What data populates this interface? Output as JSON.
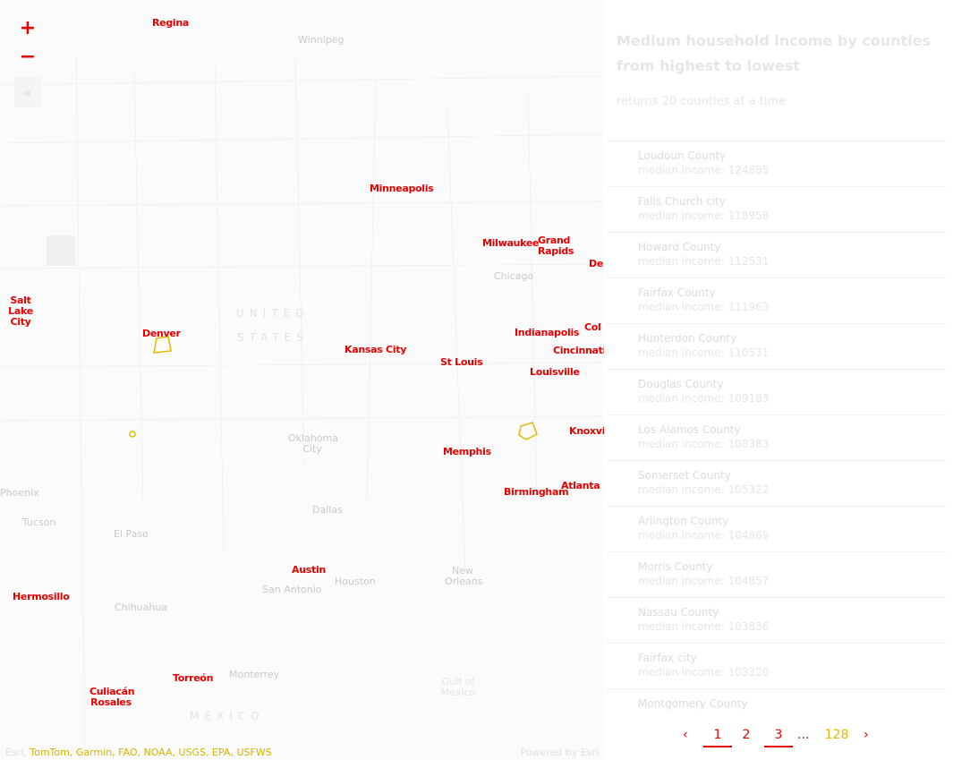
{
  "map": {
    "zoom_in_symbol": "+",
    "zoom_out_symbol": "−",
    "collapse_symbol": "«",
    "cities": [
      "Regina",
      "Minneapolis",
      "Milwaukee",
      "Grand Rapids",
      "Salt Lake City",
      "Denver",
      "Kansas City",
      "St Louis",
      "Indianapolis",
      "Cincinnati",
      "Louisville",
      "Memphis",
      "Birmingham",
      "Atlanta",
      "Austin",
      "Hermosillo",
      "Torreón",
      "Culiacán Rosales"
    ],
    "basemap_labels": [
      "Winnipeg",
      "Chicago",
      "Oklahoma City",
      "Dallas",
      "Phoenix",
      "Tucson",
      "El Paso",
      "San Antonio",
      "Houston",
      "New Orleans",
      "Chihuahua",
      "Monterrey",
      "Gulf of Mexico"
    ],
    "country_labels": [
      "UNITED",
      "STATES",
      "MEXICO"
    ],
    "edge_labels": [
      "De",
      "Col",
      "Knoxvill"
    ],
    "attribution_left_prefix": "Esri, ",
    "attribution_left": "TomTom, Garmin, FAO, NOAA, USGS, EPA, USFWS",
    "attribution_right": "Powered by Esri"
  },
  "panel": {
    "title": "Medium household income by counties from highest to lowest",
    "subtitle": "returns 20 counties at a time",
    "income_prefix": "median income: ",
    "counties": [
      {
        "name": "Loudoun County",
        "income": "124885"
      },
      {
        "name": "Falls Church city",
        "income": "118958"
      },
      {
        "name": "Howard County",
        "income": "112531"
      },
      {
        "name": "Fairfax County",
        "income": "111963"
      },
      {
        "name": "Hunterdon County",
        "income": "110531"
      },
      {
        "name": "Douglas County",
        "income": "109183"
      },
      {
        "name": "Los Alamos County",
        "income": "108383"
      },
      {
        "name": "Somerset County",
        "income": "105322"
      },
      {
        "name": "Arlington County",
        "income": "104869"
      },
      {
        "name": "Morris County",
        "income": "104857"
      },
      {
        "name": "Nassau County",
        "income": "103836"
      },
      {
        "name": "Fairfax city",
        "income": "103320"
      },
      {
        "name": "Montgomery County",
        "income": ""
      }
    ],
    "pager": {
      "prev": "‹",
      "pages": [
        "1",
        "2",
        "3"
      ],
      "ellipsis": "...",
      "last": "128",
      "next": "›"
    }
  },
  "colors": {
    "accent": "#e60000",
    "highlight": "#e6b800",
    "faded": "#e6e6e6"
  }
}
